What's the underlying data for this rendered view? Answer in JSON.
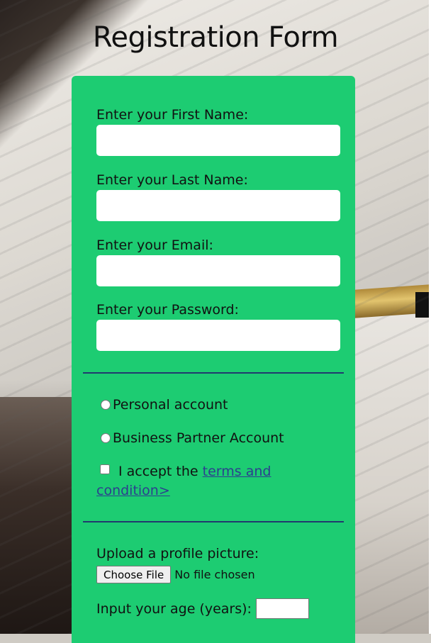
{
  "page": {
    "title": "Registration Form"
  },
  "form": {
    "first_name": {
      "label": "Enter your First Name:",
      "value": ""
    },
    "last_name": {
      "label": "Enter your Last Name:",
      "value": ""
    },
    "email": {
      "label": "Enter your Email:",
      "value": ""
    },
    "password": {
      "label": "Enter your Password:",
      "value": ""
    },
    "account_types": [
      {
        "label": "Personal account",
        "selected": false
      },
      {
        "label": "Business Partner Account",
        "selected": false
      }
    ],
    "terms": {
      "prefix": "I accept the",
      "link_text": "terms and condition>",
      "checked": false
    },
    "upload": {
      "label": "Upload a profile picture:",
      "button_label": "Choose File",
      "status": "No file chosen"
    },
    "age": {
      "label": "Input your age (years):",
      "value": ""
    }
  },
  "colors": {
    "panel": "#1dcc72",
    "divider": "#213a6e",
    "link": "#2c3f8f"
  }
}
